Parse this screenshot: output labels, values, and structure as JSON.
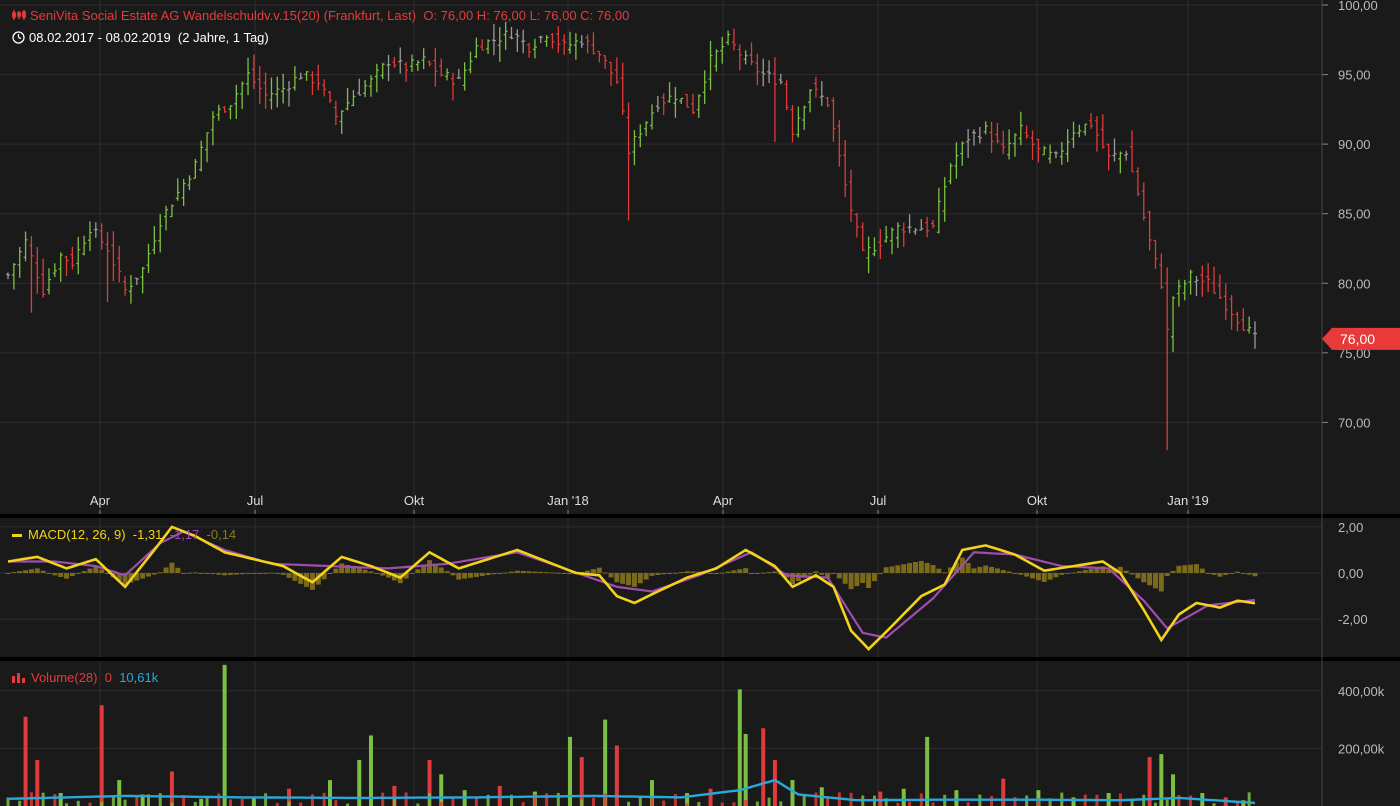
{
  "header": {
    "instrument": "SeniVita Social Estate AG Wandelschuldv.v.15(20) (Frankfurt, Last)",
    "ohlc": "O: 76,00  H: 76,00  L: 76,00  C: 76,00",
    "period": "08.02.2017 - 08.02.2019",
    "span": "(2 Jahre, 1 Tag)"
  },
  "macd_legend": {
    "label": "MACD(12, 26, 9)",
    "macd_value": "-1,31",
    "signal_value": "-1,17",
    "hist_value": "-0,14"
  },
  "volume_legend": {
    "label": "Volume(28)",
    "volume_value": "0",
    "avg_value": "10,61k"
  },
  "colors": {
    "background": "#1a1a1a",
    "grid": "#2e2e2e",
    "up": "#7bc043",
    "down": "#e03a3a",
    "neutral": "#9a9a9a",
    "macd": "#f3d21b",
    "signal": "#a04cb0",
    "histogram": "#7a6a1a",
    "volume_avg": "#2aa8d8",
    "last_tag": "#e83a3a"
  },
  "chart_data": [
    {
      "type": "ohlc",
      "title": "SeniVita Social Estate AG Wandelschuldv.v.15(20)",
      "x_ticks": [
        "Apr",
        "Jul",
        "Okt",
        "Jan '18",
        "Apr",
        "Jul",
        "Okt",
        "Jan '19"
      ],
      "y_ticks": [
        "100,00",
        "95,00",
        "90,00",
        "85,00",
        "80,00",
        "75,00",
        "70,00"
      ],
      "ylim": [
        65.5,
        100
      ],
      "last_price": 76.0,
      "last_label": "76,00",
      "close_series": [
        [
          0,
          80.6
        ],
        [
          3,
          83.0
        ],
        [
          6,
          79.5
        ],
        [
          9,
          82.0
        ],
        [
          11,
          81.5
        ],
        [
          14,
          84.0
        ],
        [
          17,
          82.5
        ],
        [
          20,
          79.5
        ],
        [
          23,
          81.0
        ],
        [
          26,
          84.5
        ],
        [
          29,
          86.5
        ],
        [
          32,
          88.5
        ],
        [
          35,
          92.0
        ],
        [
          38,
          93.0
        ],
        [
          41,
          95.0
        ],
        [
          44,
          93.5
        ],
        [
          47,
          94.0
        ],
        [
          50,
          95.0
        ],
        [
          53,
          94.5
        ],
        [
          56,
          92.0
        ],
        [
          59,
          93.5
        ],
        [
          62,
          94.5
        ],
        [
          65,
          96.0
        ],
        [
          68,
          95.5
        ],
        [
          71,
          96.0
        ],
        [
          74,
          95.0
        ],
        [
          77,
          94.5
        ],
        [
          80,
          97.0
        ],
        [
          83,
          97.5
        ],
        [
          86,
          98.0
        ],
        [
          89,
          97.0
        ],
        [
          92,
          98.0
        ],
        [
          95,
          97.0
        ],
        [
          98,
          97.5
        ],
        [
          101,
          96.5
        ],
        [
          104,
          94.5
        ],
        [
          106,
          89.5
        ],
        [
          108,
          91.0
        ],
        [
          111,
          93.0
        ],
        [
          114,
          93.5
        ],
        [
          117,
          92.5
        ],
        [
          120,
          96.0
        ],
        [
          123,
          97.5
        ],
        [
          126,
          96.0
        ],
        [
          129,
          95.0
        ],
        [
          132,
          94.5
        ],
        [
          134,
          91.0
        ],
        [
          137,
          94.0
        ],
        [
          140,
          93.0
        ],
        [
          143,
          87.0
        ],
        [
          146,
          82.0
        ],
        [
          149,
          83.0
        ],
        [
          152,
          84.0
        ],
        [
          155,
          84.0
        ],
        [
          158,
          84.0
        ],
        [
          161,
          88.5
        ],
        [
          164,
          90.5
        ],
        [
          167,
          91.0
        ],
        [
          170,
          89.5
        ],
        [
          173,
          91.0
        ],
        [
          176,
          89.5
        ],
        [
          179,
          89.0
        ],
        [
          182,
          91.0
        ],
        [
          185,
          91.5
        ],
        [
          188,
          89.0
        ],
        [
          191,
          89.5
        ],
        [
          193,
          86.5
        ],
        [
          195,
          83.0
        ],
        [
          197,
          80.0
        ],
        [
          198,
          76.5
        ],
        [
          199,
          79.0
        ],
        [
          202,
          80.5
        ],
        [
          205,
          80.0
        ],
        [
          208,
          78.5
        ],
        [
          211,
          77.0
        ],
        [
          213,
          76.0
        ]
      ]
    },
    {
      "type": "line",
      "title": "MACD(12, 26, 9)",
      "y_ticks": [
        "2,00",
        "0,00",
        "-2,00"
      ],
      "ylim": [
        -3.6,
        2.3
      ],
      "series": [
        {
          "name": "MACD",
          "values": [
            [
              0,
              0.5
            ],
            [
              5,
              0.7
            ],
            [
              10,
              0.2
            ],
            [
              15,
              0.6
            ],
            [
              20,
              -0.6
            ],
            [
              25,
              1.0
            ],
            [
              28,
              2.0
            ],
            [
              32,
              1.6
            ],
            [
              37,
              0.9
            ],
            [
              42,
              0.6
            ],
            [
              47,
              0.3
            ],
            [
              52,
              -0.4
            ],
            [
              57,
              0.7
            ],
            [
              62,
              0.3
            ],
            [
              67,
              -0.2
            ],
            [
              72,
              0.9
            ],
            [
              77,
              0.2
            ],
            [
              82,
              0.6
            ],
            [
              87,
              1.0
            ],
            [
              92,
              0.5
            ],
            [
              97,
              0.0
            ],
            [
              101,
              -0.1
            ],
            [
              104,
              -1.0
            ],
            [
              107,
              -1.3
            ],
            [
              111,
              -0.8
            ],
            [
              116,
              -0.2
            ],
            [
              121,
              0.2
            ],
            [
              126,
              1.0
            ],
            [
              131,
              0.3
            ],
            [
              134,
              -0.6
            ],
            [
              138,
              -0.1
            ],
            [
              141,
              -0.6
            ],
            [
              144,
              -2.5
            ],
            [
              147,
              -3.3
            ],
            [
              151,
              -2.3
            ],
            [
              156,
              -1.0
            ],
            [
              160,
              -0.5
            ],
            [
              163,
              1.0
            ],
            [
              167,
              1.2
            ],
            [
              172,
              0.8
            ],
            [
              177,
              0.1
            ],
            [
              182,
              0.3
            ],
            [
              187,
              0.5
            ],
            [
              190,
              0.0
            ],
            [
              194,
              -1.6
            ],
            [
              197,
              -2.9
            ],
            [
              200,
              -1.8
            ],
            [
              203,
              -1.3
            ],
            [
              207,
              -1.5
            ],
            [
              210,
              -1.2
            ],
            [
              213,
              -1.31
            ]
          ]
        },
        {
          "name": "Signal",
          "values": [
            [
              0,
              0.5
            ],
            [
              8,
              0.5
            ],
            [
              15,
              0.3
            ],
            [
              20,
              -0.1
            ],
            [
              26,
              1.3
            ],
            [
              30,
              1.8
            ],
            [
              37,
              1.0
            ],
            [
              45,
              0.4
            ],
            [
              55,
              0.3
            ],
            [
              65,
              0.2
            ],
            [
              75,
              0.4
            ],
            [
              87,
              0.9
            ],
            [
              95,
              0.2
            ],
            [
              104,
              -0.6
            ],
            [
              110,
              -0.8
            ],
            [
              118,
              -0.1
            ],
            [
              127,
              0.9
            ],
            [
              133,
              -0.1
            ],
            [
              140,
              -0.2
            ],
            [
              146,
              -2.6
            ],
            [
              150,
              -2.8
            ],
            [
              158,
              -1.1
            ],
            [
              165,
              0.9
            ],
            [
              172,
              0.8
            ],
            [
              180,
              0.3
            ],
            [
              188,
              0.2
            ],
            [
              194,
              -1.2
            ],
            [
              198,
              -2.4
            ],
            [
              205,
              -1.4
            ],
            [
              213,
              -1.17
            ]
          ]
        }
      ]
    },
    {
      "type": "bar",
      "title": "Volume(28)",
      "y_ticks": [
        "400,00k",
        "200,00k"
      ],
      "ylim": [
        0,
        500
      ],
      "bars": [
        [
          3,
          310,
          "down"
        ],
        [
          5,
          160,
          "down"
        ],
        [
          9,
          45,
          "up"
        ],
        [
          16,
          350,
          "down"
        ],
        [
          19,
          90,
          "up"
        ],
        [
          23,
          40,
          "up"
        ],
        [
          28,
          120,
          "down"
        ],
        [
          33,
          25,
          "up"
        ],
        [
          37,
          490,
          "up"
        ],
        [
          42,
          30,
          "up"
        ],
        [
          48,
          60,
          "down"
        ],
        [
          55,
          90,
          "up"
        ],
        [
          60,
          160,
          "up"
        ],
        [
          62,
          245,
          "up"
        ],
        [
          66,
          70,
          "down"
        ],
        [
          72,
          160,
          "down"
        ],
        [
          74,
          110,
          "up"
        ],
        [
          78,
          55,
          "up"
        ],
        [
          84,
          70,
          "down"
        ],
        [
          90,
          50,
          "up"
        ],
        [
          96,
          240,
          "up"
        ],
        [
          98,
          170,
          "down"
        ],
        [
          102,
          300,
          "up"
        ],
        [
          104,
          210,
          "down"
        ],
        [
          110,
          90,
          "up"
        ],
        [
          116,
          45,
          "up"
        ],
        [
          120,
          60,
          "down"
        ],
        [
          125,
          405,
          "up"
        ],
        [
          126,
          250,
          "up"
        ],
        [
          129,
          270,
          "down"
        ],
        [
          131,
          160,
          "down"
        ],
        [
          134,
          90,
          "up"
        ],
        [
          139,
          65,
          "up"
        ],
        [
          149,
          50,
          "down"
        ],
        [
          153,
          60,
          "up"
        ],
        [
          157,
          240,
          "up"
        ],
        [
          162,
          55,
          "up"
        ],
        [
          170,
          95,
          "down"
        ],
        [
          176,
          55,
          "up"
        ],
        [
          182,
          30,
          "up"
        ],
        [
          188,
          45,
          "up"
        ],
        [
          195,
          170,
          "down"
        ],
        [
          197,
          180,
          "up"
        ],
        [
          199,
          110,
          "up"
        ],
        [
          204,
          45,
          "up"
        ],
        [
          208,
          30,
          "down"
        ],
        [
          211,
          20,
          "up"
        ]
      ],
      "avg_series": [
        [
          0,
          25
        ],
        [
          20,
          35
        ],
        [
          40,
          30
        ],
        [
          60,
          28
        ],
        [
          80,
          30
        ],
        [
          100,
          35
        ],
        [
          115,
          30
        ],
        [
          125,
          55
        ],
        [
          131,
          90
        ],
        [
          135,
          40
        ],
        [
          145,
          20
        ],
        [
          160,
          22
        ],
        [
          175,
          22
        ],
        [
          190,
          20
        ],
        [
          200,
          28
        ],
        [
          213,
          10.61
        ]
      ]
    }
  ]
}
